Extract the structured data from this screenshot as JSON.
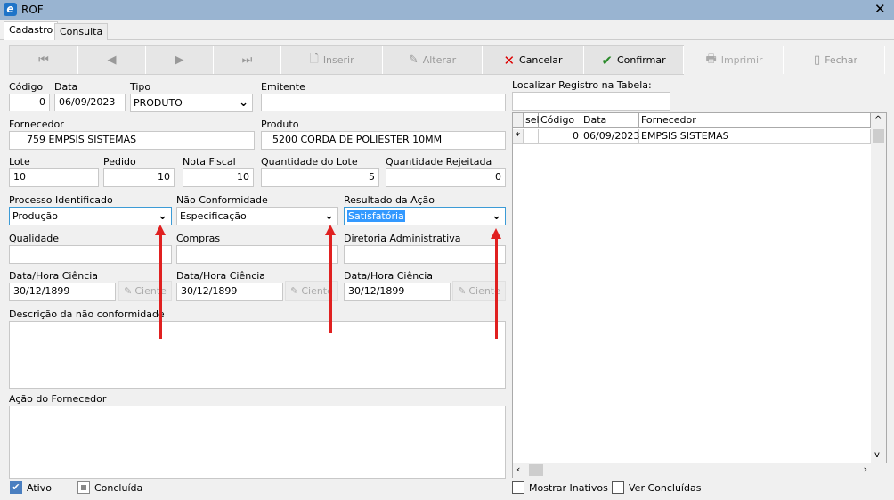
{
  "window": {
    "title": "ROF",
    "close": "✕"
  },
  "tabs": [
    "Cadastro",
    "Consulta"
  ],
  "toolbar": {
    "first": "⏮",
    "prev": "◀",
    "next": "▶",
    "last": "⏭",
    "insert": "Inserir",
    "alter": "Alterar",
    "cancel": "Cancelar",
    "confirm": "Confirmar",
    "print": "Imprimir",
    "close": "Fechar"
  },
  "form": {
    "codigo_label": "Código",
    "codigo": "0",
    "data_label": "Data",
    "data": "06/09/2023",
    "tipo_label": "Tipo",
    "tipo": "PRODUTO",
    "emitente_label": "Emitente",
    "emitente": "",
    "fornecedor_label": "Fornecedor",
    "fornecedor_cod": "759",
    "fornecedor": "EMPSIS SISTEMAS",
    "produto_label": "Produto",
    "produto_cod": "5200",
    "produto": "CORDA DE POLIESTER 10MM",
    "lote_label": "Lote",
    "lote": "10",
    "pedido_label": "Pedido",
    "pedido": "10",
    "nf_label": "Nota Fiscal",
    "nf": "10",
    "qtd_lote_label": "Quantidade do Lote",
    "qtd_lote": "5",
    "qtd_rej_label": "Quantidade Rejeitada",
    "qtd_rej": "0",
    "processo_label": "Processo Identificado",
    "processo": "Produção",
    "nao_conf_label": "Não Conformidade",
    "nao_conf": "Especificação",
    "resultado_label": "Resultado da Ação",
    "resultado": "Satisfatória",
    "qualidade_label": "Qualidade",
    "compras_label": "Compras",
    "diretoria_label": "Diretoria Administrativa",
    "dh_label": "Data/Hora Ciência",
    "dh1": "30/12/1899",
    "dh2": "30/12/1899",
    "dh3": "30/12/1899",
    "ciente": "Ciente",
    "descricao_label": "Descrição da não conformidade",
    "acao_label": "Ação do Fornecedor",
    "ativo": "Ativo",
    "concluida": "Concluída"
  },
  "grid": {
    "search_label": "Localizar Registro na Tabela:",
    "headers": [
      "sel",
      "Código",
      "Data",
      "Fornecedor"
    ],
    "row": {
      "marker": "*",
      "codigo": "0",
      "data": "06/09/2023",
      "fornecedor": "EMPSIS SISTEMAS"
    },
    "show_inactive": "Mostrar Inativos",
    "show_done": "Ver Concluídas"
  }
}
